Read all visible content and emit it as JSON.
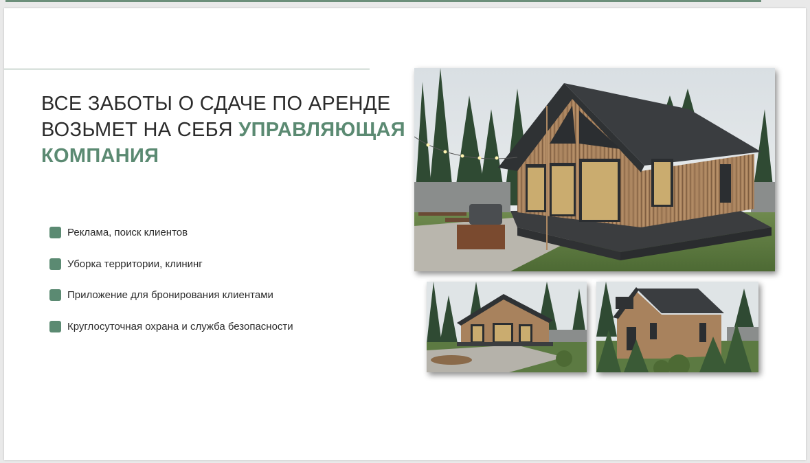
{
  "headline": {
    "line1": "ВСЕ ЗАБОТЫ О СДАЧЕ ПО АРЕНДЕ",
    "line2_plain": "ВОЗЬМЕТ НА СЕБЯ ",
    "line2_accent": "УПРАВЛЯЮЩАЯ",
    "line3_accent": "КОМПАНИЯ"
  },
  "bullets": [
    "Реклама, поиск клиентов",
    "Уборка территории, клининг",
    "Приложение для бронирования клиентами",
    "Круглосуточная охрана и служба безопасности"
  ],
  "colors": {
    "accent": "#5b8a72",
    "text": "#2b2b2b",
    "rule": "#8aa597"
  },
  "images": {
    "main": "house-render-front",
    "left": "house-render-side-firepit",
    "right": "house-render-rear-trees"
  }
}
